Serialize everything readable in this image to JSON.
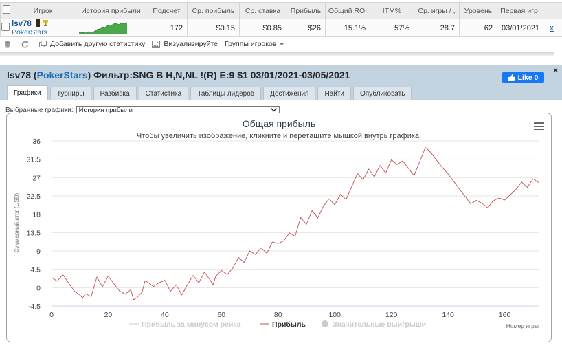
{
  "table": {
    "headers": [
      "Игрок",
      "История прибыли",
      "Подсчет",
      "Ср. прибыль",
      "Ср. ставка",
      "Прибыль",
      "Общий ROI",
      "ITM%",
      "Ср. игры / ,",
      "Уровень",
      "Первая игр"
    ],
    "row": {
      "player": "lsv78",
      "network": "PokerStars",
      "count": "172",
      "avg_profit": "$0.15",
      "avg_stake": "$0.85",
      "profit": "$26",
      "roi": "15.1%",
      "itm": "57%",
      "avg_games": "28.7",
      "level": "62",
      "first_game": "03/01/2021",
      "remove": "x"
    }
  },
  "toolbar": {
    "add_stat": "Добавить другую статистику",
    "visualize": "Визуализируйте",
    "groups": "Группы игроков"
  },
  "panel": {
    "title_player": "lsv78",
    "title_network": "PokerStars",
    "title_filter": "Фильтр:SNG B H,N,NL !(R) E:9 $1 03/01/2021-03/05/2021",
    "close": "×",
    "like": "Like 0",
    "tabs": [
      "Графики",
      "Турниры",
      "Разбивка",
      "Статистика",
      "Таблицы лидеров",
      "Достижения",
      "Найти",
      "Опубликовать"
    ],
    "active_tab": "Графики",
    "select_label": "Выбранные графики:",
    "select_value": "История прибыли"
  },
  "colors": {
    "series": "#c0504d",
    "link": "#1b4f9c",
    "panel_bg": "#c4d3e0",
    "like": "#1877f2"
  },
  "chart_data": {
    "type": "line",
    "title": "Общая прибыль",
    "subtitle": "Чтобы увеличить изображение, кликните и перетащите мышкой внутрь графика.",
    "xlabel": "Номер игры",
    "ylabel": "Суммарный итог (USD)",
    "xlim": [
      0,
      172
    ],
    "ylim": [
      -4.5,
      36
    ],
    "xticks": [
      0,
      20,
      40,
      60,
      80,
      100,
      120,
      140,
      160
    ],
    "yticks": [
      -4.5,
      0,
      4.5,
      9,
      13.5,
      18,
      22.5,
      27,
      31.5,
      36
    ],
    "grid": "horizontal",
    "legend": {
      "position": "bottom",
      "items": [
        "Прибыль за минусом рейка",
        "Прибыль",
        "Значительные выигрыши"
      ]
    },
    "series": [
      {
        "name": "Прибыль",
        "x": [
          0,
          2,
          4,
          6,
          8,
          10,
          11,
          12,
          14,
          16,
          18,
          20,
          22,
          24,
          26,
          28,
          29,
          30,
          32,
          33,
          34,
          36,
          38,
          40,
          42,
          44,
          46,
          48,
          50,
          52,
          54,
          56,
          57,
          58,
          60,
          62,
          64,
          66,
          68,
          70,
          72,
          74,
          76,
          78,
          80,
          82,
          84,
          86,
          88,
          90,
          92,
          94,
          96,
          98,
          100,
          102,
          104,
          106,
          108,
          110,
          112,
          114,
          116,
          118,
          120,
          122,
          124,
          126,
          128,
          130,
          132,
          133,
          134,
          136,
          138,
          140,
          142,
          144,
          146,
          148,
          150,
          152,
          154,
          156,
          158,
          160,
          162,
          164,
          166,
          168,
          170,
          172
        ],
        "y": [
          2.5,
          1.6,
          3.2,
          1.2,
          -0.8,
          -1.8,
          -2.5,
          -1.5,
          -2.2,
          2.6,
          0.2,
          2.8,
          1.0,
          -0.8,
          -1.6,
          -0.5,
          -3.0,
          -2.5,
          -1.1,
          1.7,
          1.3,
          0.3,
          1.2,
          1.8,
          -0.9,
          0.7,
          -1.8,
          0.8,
          3.0,
          1.2,
          3.8,
          1.9,
          0.7,
          2.8,
          4.2,
          3.2,
          4.8,
          7.4,
          6.2,
          9.0,
          8.1,
          9.8,
          8.4,
          11.2,
          10.8,
          11.5,
          13.4,
          12.6,
          17.2,
          15.5,
          18.9,
          17.1,
          20.0,
          21.8,
          20.3,
          22.9,
          21.6,
          24.8,
          28.0,
          26.5,
          29.1,
          27.2,
          30.0,
          28.1,
          31.4,
          30.2,
          31.1,
          29.3,
          27.5,
          30.9,
          34.4,
          33.8,
          33.1,
          31.2,
          29.5,
          27.9,
          26.1,
          24.2,
          22.4,
          20.6,
          21.4,
          20.7,
          19.6,
          21.3,
          22.0,
          21.5,
          22.8,
          24.1,
          25.9,
          24.6,
          26.7,
          25.8
        ]
      }
    ]
  }
}
